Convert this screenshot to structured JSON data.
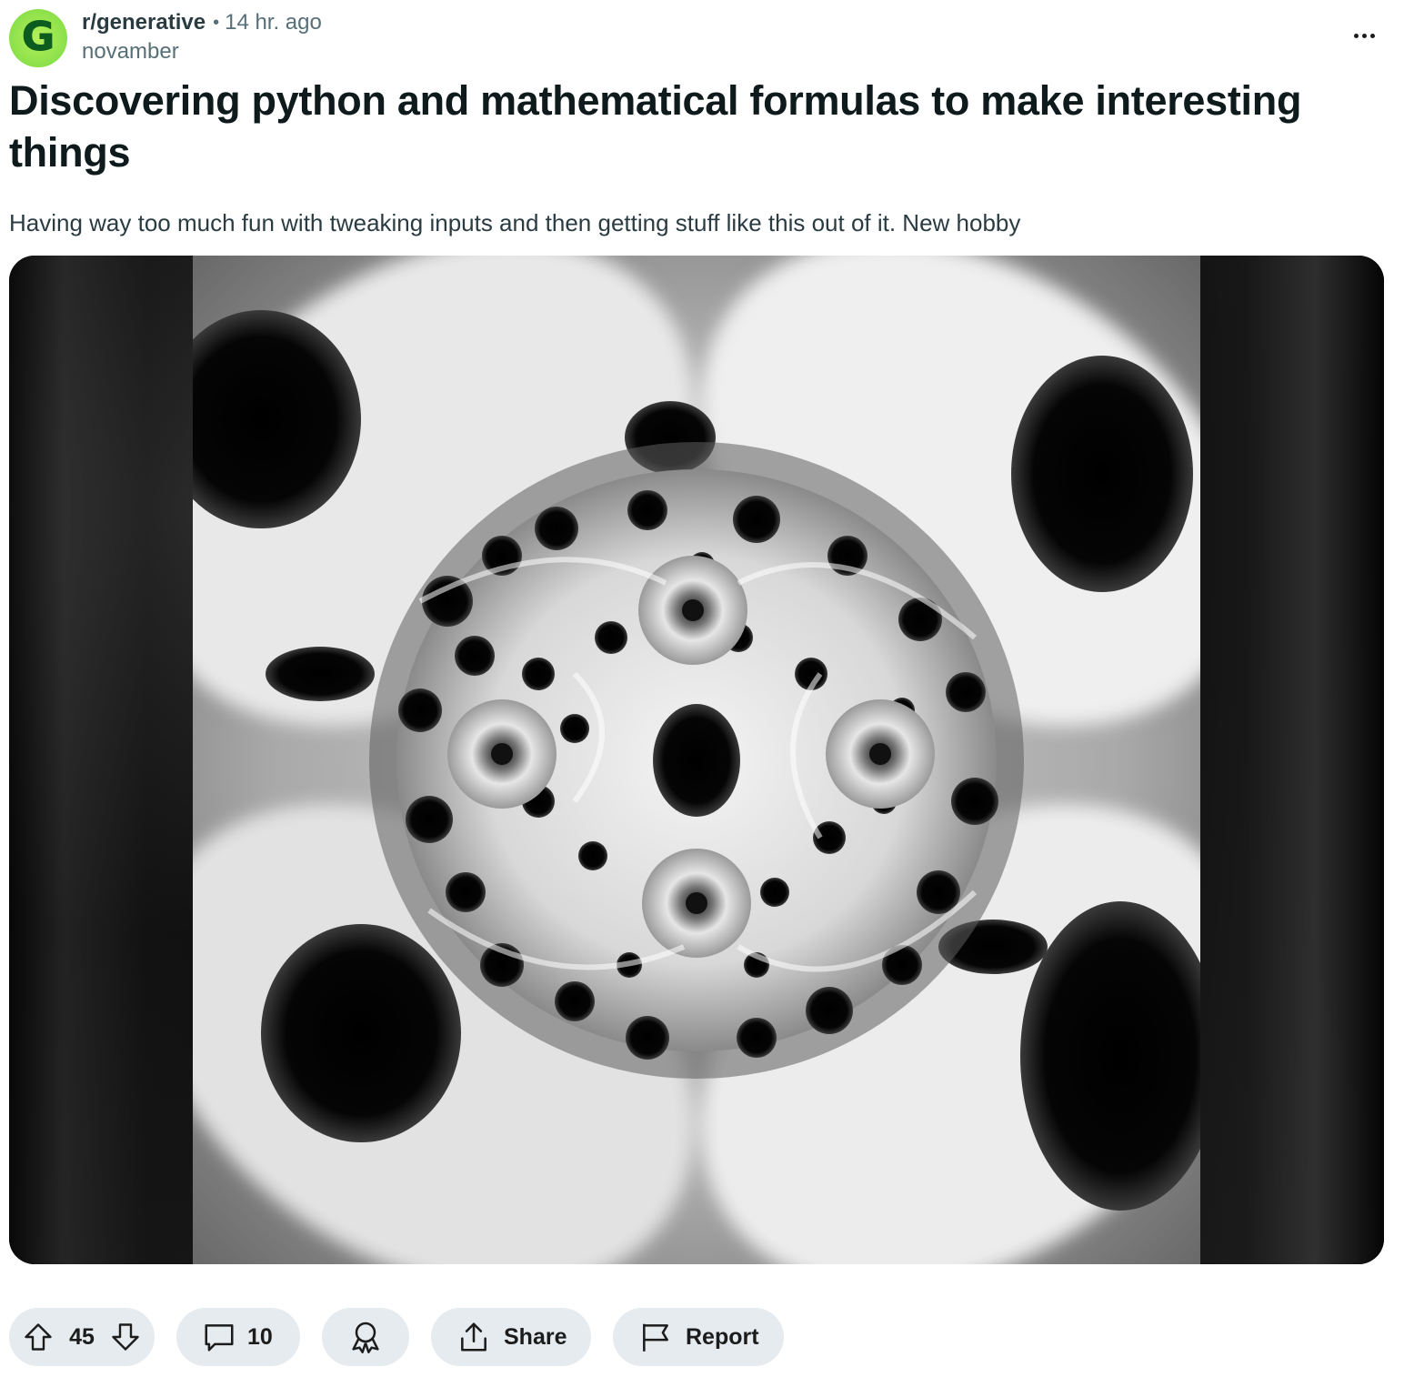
{
  "post": {
    "subreddit": "r/generative",
    "separator": "•",
    "time": "14 hr. ago",
    "author": "novamber",
    "avatar_letter": "G",
    "title": "Discovering python and mathematical formulas to make interesting things",
    "body": "Having way too much fun with tweaking inputs and then getting stuff like this out of it. New hobby"
  },
  "actions": {
    "score": "45",
    "comments": "10",
    "share_label": "Share",
    "report_label": "Report"
  },
  "icons": {
    "more": "more-options-icon",
    "upvote": "upvote-arrow-icon",
    "downvote": "downvote-arrow-icon",
    "comment": "comment-bubble-icon",
    "award": "award-icon",
    "share": "share-upload-icon",
    "report": "flag-icon"
  },
  "colors": {
    "avatar_bg": "#8be04a",
    "avatar_letter": "#0d5c1f",
    "pill_bg": "#e5ebee",
    "meta_text": "#576f76"
  }
}
